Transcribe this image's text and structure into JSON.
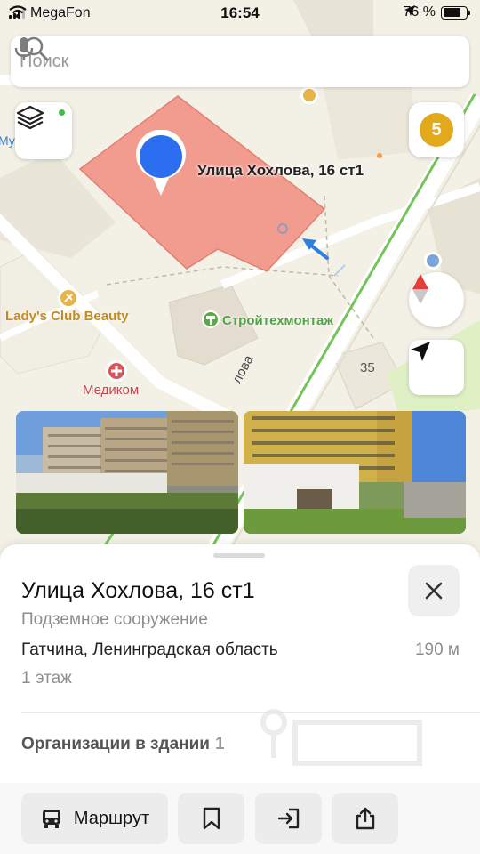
{
  "status_bar": {
    "carrier": "MegaFon",
    "time": "16:54",
    "battery_percent": "76 %",
    "battery_level": 0.76
  },
  "search": {
    "placeholder": "Поиск"
  },
  "map": {
    "badge_count": "5",
    "address_label": "Улица Хохлова, 16 ст1",
    "poi_ladys": "Lady's Club Beauty",
    "poi_stroy": "Стройтехмонтаж",
    "poi_medikom": "Медиком",
    "house_35": "35",
    "street_fragment": "лова",
    "edge_fragment": "Му",
    "colors": {
      "building": "#f29b8f",
      "pin": "#2b6ef0",
      "road_green": "#73c45a"
    }
  },
  "card": {
    "title": "Улица Хохлова, 16 ст1",
    "subtitle": "Подземное сооружение",
    "city": "Гатчина, Ленинградская область",
    "distance": "190 м",
    "floors": "1 этаж",
    "orgs_label": "Организации в здании",
    "orgs_count": "1"
  },
  "toolbar": {
    "route_label": "Маршрут",
    "icons": [
      "bus-icon",
      "bookmark-icon",
      "enter-icon",
      "share-icon"
    ]
  }
}
